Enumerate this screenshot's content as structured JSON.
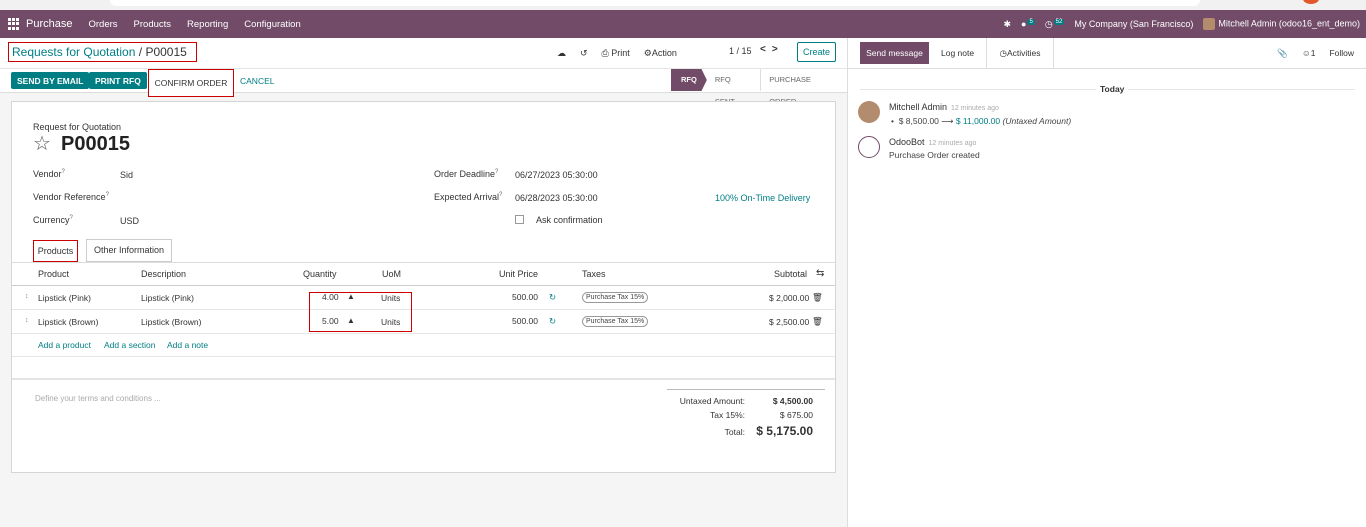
{
  "navbar": {
    "brand": "Purchase",
    "menus": [
      "Orders",
      "Products",
      "Reporting",
      "Configuration"
    ],
    "chat_count": "5",
    "activity_count": "52",
    "company": "My Company (San Francisco)",
    "user": "Mitchell Admin (odoo16_ent_demo)"
  },
  "control_panel": {
    "breadcrumb_parent": "Requests for Quotation",
    "breadcrumb_sep": "/",
    "breadcrumb_current": "P00015",
    "print_label": "Print",
    "action_label": "Action",
    "pager": "1 / 15",
    "create_label": "Create"
  },
  "actions": {
    "send_email": "SEND BY EMAIL",
    "print_rfq": "PRINT RFQ",
    "confirm_order": "CONFIRM ORDER",
    "cancel": "CANCEL"
  },
  "status_stages": [
    "RFQ",
    "RFQ SENT",
    "PURCHASE ORDER"
  ],
  "form": {
    "title_label": "Request for Quotation",
    "reference": "P00015",
    "vendor_label": "Vendor",
    "vendor_value": "Sid",
    "vendor_ref_label": "Vendor Reference",
    "currency_label": "Currency",
    "currency_value": "USD",
    "order_deadline_label": "Order Deadline",
    "order_deadline_value": "06/27/2023 05:30:00",
    "expected_arrival_label": "Expected Arrival",
    "expected_arrival_value": "06/28/2023 05:30:00",
    "on_time_delivery": "100% On-Time Delivery",
    "ask_confirmation_label": "Ask confirmation",
    "help_mark": "?"
  },
  "tabs": {
    "products": "Products",
    "other_info": "Other Information"
  },
  "table": {
    "headers": {
      "product": "Product",
      "description": "Description",
      "quantity": "Quantity",
      "uom": "UoM",
      "unit_price": "Unit Price",
      "taxes": "Taxes",
      "subtotal": "Subtotal"
    },
    "rows": [
      {
        "product": "Lipstick (Pink)",
        "description": "Lipstick (Pink)",
        "quantity": "4.00",
        "uom": "Units",
        "unit_price": "500.00",
        "tax": "Purchase Tax 15%",
        "subtotal": "$ 2,000.00"
      },
      {
        "product": "Lipstick (Brown)",
        "description": "Lipstick (Brown)",
        "quantity": "5.00",
        "uom": "Units",
        "unit_price": "500.00",
        "tax": "Purchase Tax 15%",
        "subtotal": "$ 2,500.00"
      }
    ],
    "add_product": "Add a product",
    "add_section": "Add a section",
    "add_note": "Add a note"
  },
  "footer": {
    "terms_placeholder": "Define your terms and conditions ...",
    "untaxed_label": "Untaxed Amount:",
    "untaxed_value": "$ 4,500.00",
    "tax_label": "Tax 15%:",
    "tax_value": "$ 675.00",
    "total_label": "Total:",
    "total_value": "$ 5,175.00"
  },
  "chatter": {
    "send_message": "Send message",
    "log_note": "Log note",
    "activities": "Activities",
    "followers_count": "1",
    "follow": "Follow",
    "today": "Today",
    "messages": [
      {
        "author": "Mitchell Admin",
        "time": "12 minutes ago",
        "old_value": "$ 8,500.00",
        "new_value": "$ 11,000.00",
        "field": "(Untaxed Amount)"
      },
      {
        "author": "OdooBot",
        "time": "12 minutes ago",
        "body": "Purchase Order created"
      }
    ]
  },
  "colors": {
    "brand": "#714b67",
    "accent": "#017e84",
    "highlight": "#cc0000"
  }
}
